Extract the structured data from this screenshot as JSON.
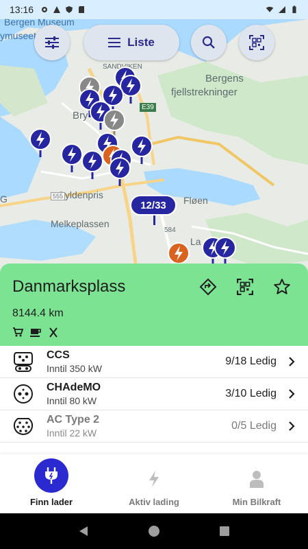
{
  "statusbar": {
    "time": "13:16"
  },
  "toolbar": {
    "filter_icon": "sliders-icon",
    "list_label": "Liste",
    "search_icon": "search-icon",
    "qr_icon": "qr-scan-icon"
  },
  "map": {
    "labels": {
      "museum": "Bergen Museum",
      "museum2": "ymuseet",
      "sandviken": "SANDVIKEN",
      "bergens": "Bergens",
      "fjell": "fjellstrekninger",
      "e39": "E39",
      "bry": "Bry",
      "gyldenpris": "Gyldenpris",
      "n555": "555",
      "floen": "Fløen",
      "melke": "Melkeplassen",
      "n584": "584",
      "g": "G",
      "la": "La"
    },
    "cluster_label": "12/33"
  },
  "station": {
    "name": "Danmarksplass",
    "distance": "8144.4 km",
    "amenities": [
      "cart-icon",
      "coffee-icon",
      "restaurant-icon"
    ],
    "actions": [
      "directions-icon",
      "qr-scan-icon",
      "star-outline-icon"
    ]
  },
  "connectors": [
    {
      "name": "CCS",
      "power": "Inntil 350 kW",
      "availability": "9/18 Ledig",
      "icon": "ccs-connector-icon"
    },
    {
      "name": "CHAdeMO",
      "power": "Inntil 80 kW",
      "availability": "3/10 Ledig",
      "icon": "chademo-connector-icon"
    },
    {
      "name": "AC Type 2",
      "power": "Inntil 22 kW",
      "availability": "0/5 Ledig",
      "icon": "type2-connector-icon"
    }
  ],
  "bottomnav": {
    "items": [
      {
        "label": "Finn lader",
        "icon": "plug-icon"
      },
      {
        "label": "Aktiv lading",
        "icon": "bolt-icon"
      },
      {
        "label": "Min Bilkraft",
        "icon": "person-icon"
      }
    ]
  },
  "colors": {
    "accent": "#2a2ad0",
    "marker_blue": "#2626a0",
    "marker_gray": "#888888",
    "marker_orange": "#d8621e",
    "sheet_green": "#7be392"
  }
}
